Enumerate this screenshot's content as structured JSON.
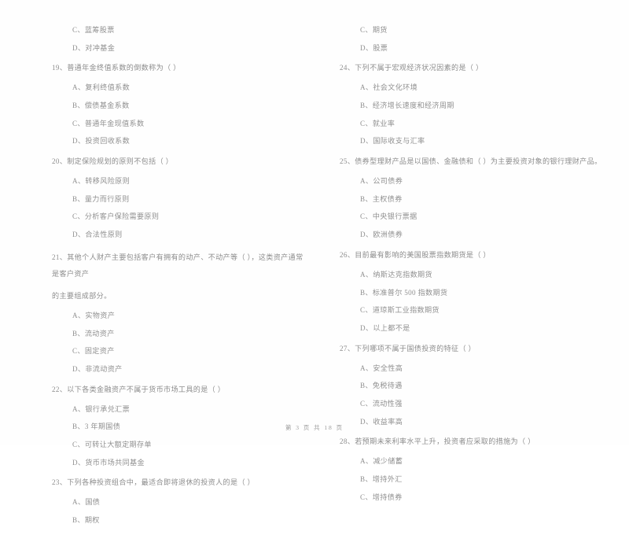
{
  "document": {
    "type": "exam-paper",
    "language": "zh-CN",
    "text_color": "#8e8e8e",
    "background_color": "#fefefe"
  },
  "left_column": {
    "carryover_options": [
      "C、蓝筹股票",
      "D、对冲基金"
    ],
    "questions": [
      {
        "number": "19",
        "stem": "19、普通年金终值系数的倒数称为（    ）",
        "stem_line2": "",
        "options": [
          "A、复利终值系数",
          "B、偿债基金系数",
          "C、普通年金现值系数",
          "D、投资回收系数"
        ]
      },
      {
        "number": "20",
        "stem": "20、制定保险规划的原则不包括（    ）",
        "stem_line2": "",
        "options": [
          "A、转移风险原则",
          "B、量力而行原则",
          "C、分析客户保险需要原则",
          "D、合法性原则"
        ]
      },
      {
        "number": "21",
        "stem": "21、其他个人财产主要包括客户有拥有的动产、不动产等（    ），这类资产通常是客户资产",
        "stem_line2": "的主要组成部分。",
        "options": [
          "A、实物资产",
          "B、流动资产",
          "C、固定资产",
          "D、非流动资产"
        ]
      },
      {
        "number": "22",
        "stem": "22、以下各类金融资产不属于货币市场工具的是（    ）",
        "stem_line2": "",
        "options": [
          "A、银行承兑汇票",
          "B、3 年期国债",
          "C、可转让大额定期存单",
          "D、货币市场共同基金"
        ]
      },
      {
        "number": "23",
        "stem": "23、下列各种投资组合中，最适合即将退休的投资人的是（    ）",
        "stem_line2": "",
        "options": [
          "A、国债",
          "B、期权"
        ]
      }
    ]
  },
  "right_column": {
    "carryover_options": [
      "C、期货",
      "D、股票"
    ],
    "questions": [
      {
        "number": "24",
        "stem": "24、下列不属于宏观经济状况因素的是（    ）",
        "stem_line2": "",
        "options": [
          "A、社会文化环境",
          "B、经济增长速度和经济周期",
          "C、就业率",
          "D、国际收支与汇率"
        ]
      },
      {
        "number": "25",
        "stem": "25、债券型理财产品是以国债、金融债和（    ）为主要投资对象的银行理财产品。",
        "stem_line2": "",
        "options": [
          "A、公司债券",
          "B、主权债券",
          "C、中央银行票据",
          "D、欧洲债券"
        ]
      },
      {
        "number": "26",
        "stem": "26、目前最有影响的美国股票指数期货是（    ）",
        "stem_line2": "",
        "options": [
          "A、纳斯达克指数期货",
          "B、标准普尔 500 指数期货",
          "C、道琼斯工业指数期货",
          "D、以上都不是"
        ]
      },
      {
        "number": "27",
        "stem": "27、下列哪项不属于国债投资的特征（    ）",
        "stem_line2": "",
        "options": [
          "A、安全性高",
          "B、免税待遇",
          "C、流动性强",
          "D、收益率高"
        ]
      },
      {
        "number": "28",
        "stem": "28、若预期未来利率水平上升，投资者应采取的措施为（    ）",
        "stem_line2": "",
        "options": [
          "A、减少储蓄",
          "B、增持外汇",
          "C、增持债券"
        ]
      }
    ]
  },
  "footer": {
    "text": "第 3 页 共 18 页"
  }
}
